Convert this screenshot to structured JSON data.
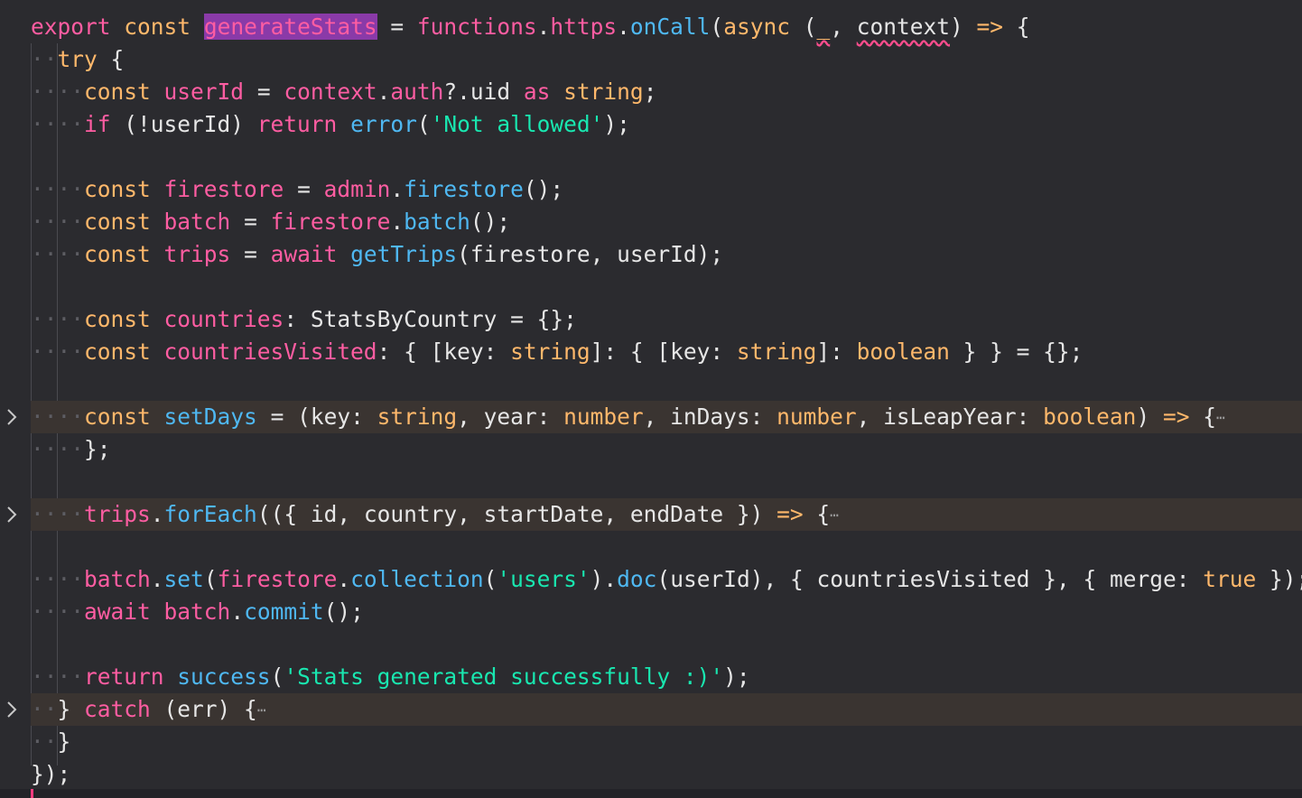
{
  "editor": {
    "colors": {
      "keyword": "#ff5da2",
      "type_or_binding": "#ffb86b",
      "function": "#4fb8f2",
      "string": "#19e7b0",
      "plain": "#e6e6e6",
      "selection": "#8a3aa8",
      "folded_line_background": "#3a3431",
      "error_squiggle": "#ff4d8d"
    },
    "lines": [
      {
        "tokens": [
          {
            "t": "export",
            "c": "kw"
          },
          {
            "t": " "
          },
          {
            "t": "const",
            "c": "tk"
          },
          {
            "t": " "
          },
          {
            "t": "generateStats",
            "c": "kw",
            "s": "sel"
          },
          {
            "t": " = "
          },
          {
            "t": "functions",
            "c": "kw"
          },
          {
            "t": "."
          },
          {
            "t": "https",
            "c": "kw"
          },
          {
            "t": "."
          },
          {
            "t": "onCall",
            "c": "fn"
          },
          {
            "t": "("
          },
          {
            "t": "async",
            "c": "tk"
          },
          {
            "t": " ("
          },
          {
            "t": "_",
            "c": "tk",
            "s": "squig"
          },
          {
            "t": ", "
          },
          {
            "t": "context",
            "c": "pl",
            "s": "squig"
          },
          {
            "t": ") "
          },
          {
            "t": "=>",
            "c": "tk"
          },
          {
            "t": " {"
          }
        ]
      },
      {
        "indent": 1,
        "tokens": [
          {
            "t": "try",
            "c": "tk"
          },
          {
            "t": " {"
          }
        ]
      },
      {
        "indent": 2,
        "tokens": [
          {
            "t": "const",
            "c": "tk"
          },
          {
            "t": " "
          },
          {
            "t": "userId",
            "c": "kw"
          },
          {
            "t": " = "
          },
          {
            "t": "context",
            "c": "kw"
          },
          {
            "t": "."
          },
          {
            "t": "auth",
            "c": "kw"
          },
          {
            "t": "?.uid "
          },
          {
            "t": "as",
            "c": "kw"
          },
          {
            "t": " "
          },
          {
            "t": "string",
            "c": "tk"
          },
          {
            "t": ";"
          }
        ]
      },
      {
        "indent": 2,
        "tokens": [
          {
            "t": "if",
            "c": "kw"
          },
          {
            "t": " (!userId) "
          },
          {
            "t": "return",
            "c": "kw"
          },
          {
            "t": " "
          },
          {
            "t": "error",
            "c": "fn"
          },
          {
            "t": "("
          },
          {
            "t": "'Not allowed'",
            "c": "str"
          },
          {
            "t": ");"
          }
        ]
      },
      {
        "tokens": []
      },
      {
        "indent": 2,
        "tokens": [
          {
            "t": "const",
            "c": "tk"
          },
          {
            "t": " "
          },
          {
            "t": "firestore",
            "c": "kw"
          },
          {
            "t": " = "
          },
          {
            "t": "admin",
            "c": "kw"
          },
          {
            "t": "."
          },
          {
            "t": "firestore",
            "c": "fn"
          },
          {
            "t": "();"
          }
        ]
      },
      {
        "indent": 2,
        "tokens": [
          {
            "t": "const",
            "c": "tk"
          },
          {
            "t": " "
          },
          {
            "t": "batch",
            "c": "kw"
          },
          {
            "t": " = "
          },
          {
            "t": "firestore",
            "c": "kw"
          },
          {
            "t": "."
          },
          {
            "t": "batch",
            "c": "fn"
          },
          {
            "t": "();"
          }
        ]
      },
      {
        "indent": 2,
        "tokens": [
          {
            "t": "const",
            "c": "tk"
          },
          {
            "t": " "
          },
          {
            "t": "trips",
            "c": "kw"
          },
          {
            "t": " = "
          },
          {
            "t": "await",
            "c": "kw"
          },
          {
            "t": " "
          },
          {
            "t": "getTrips",
            "c": "fn"
          },
          {
            "t": "(firestore, userId);"
          }
        ]
      },
      {
        "tokens": []
      },
      {
        "indent": 2,
        "tokens": [
          {
            "t": "const",
            "c": "tk"
          },
          {
            "t": " "
          },
          {
            "t": "countries",
            "c": "kw"
          },
          {
            "t": ": StatsByCountry = {};"
          }
        ]
      },
      {
        "indent": 2,
        "tokens": [
          {
            "t": "const",
            "c": "tk"
          },
          {
            "t": " "
          },
          {
            "t": "countriesVisited",
            "c": "kw"
          },
          {
            "t": ": { [key: "
          },
          {
            "t": "string",
            "c": "tk"
          },
          {
            "t": "]: { [key: "
          },
          {
            "t": "string",
            "c": "tk"
          },
          {
            "t": "]: "
          },
          {
            "t": "boolean",
            "c": "tk"
          },
          {
            "t": " } } = {};"
          }
        ]
      },
      {
        "tokens": []
      },
      {
        "indent": 2,
        "folded": true,
        "tokens": [
          {
            "t": "const",
            "c": "tk"
          },
          {
            "t": " "
          },
          {
            "t": "setDays",
            "c": "fn"
          },
          {
            "t": " = (key: "
          },
          {
            "t": "string",
            "c": "tk"
          },
          {
            "t": ", year: "
          },
          {
            "t": "number",
            "c": "tk"
          },
          {
            "t": ", inDays: "
          },
          {
            "t": "number",
            "c": "tk"
          },
          {
            "t": ", isLeapYear: "
          },
          {
            "t": "boolean",
            "c": "tk"
          },
          {
            "t": ") "
          },
          {
            "t": "=>",
            "c": "tk"
          },
          {
            "t": " {"
          },
          {
            "t": "⋯",
            "c": "ell"
          }
        ]
      },
      {
        "indent": 2,
        "tokens": [
          {
            "t": "};"
          }
        ]
      },
      {
        "tokens": []
      },
      {
        "indent": 2,
        "folded": true,
        "tokens": [
          {
            "t": "trips",
            "c": "kw"
          },
          {
            "t": "."
          },
          {
            "t": "forEach",
            "c": "fn"
          },
          {
            "t": "(({ id, country, startDate, endDate }) "
          },
          {
            "t": "=>",
            "c": "tk"
          },
          {
            "t": " {"
          },
          {
            "t": "⋯",
            "c": "ell"
          }
        ]
      },
      {
        "tokens": []
      },
      {
        "indent": 2,
        "tokens": [
          {
            "t": "batch",
            "c": "kw"
          },
          {
            "t": "."
          },
          {
            "t": "set",
            "c": "fn"
          },
          {
            "t": "("
          },
          {
            "t": "firestore",
            "c": "kw"
          },
          {
            "t": "."
          },
          {
            "t": "collection",
            "c": "fn"
          },
          {
            "t": "("
          },
          {
            "t": "'users'",
            "c": "str"
          },
          {
            "t": ")."
          },
          {
            "t": "doc",
            "c": "fn"
          },
          {
            "t": "(userId), { countriesVisited }, { merge: "
          },
          {
            "t": "true",
            "c": "tk"
          },
          {
            "t": " });"
          }
        ]
      },
      {
        "indent": 2,
        "tokens": [
          {
            "t": "await",
            "c": "kw"
          },
          {
            "t": " "
          },
          {
            "t": "batch",
            "c": "kw"
          },
          {
            "t": "."
          },
          {
            "t": "commit",
            "c": "fn"
          },
          {
            "t": "();"
          }
        ]
      },
      {
        "tokens": []
      },
      {
        "indent": 2,
        "tokens": [
          {
            "t": "return",
            "c": "kw"
          },
          {
            "t": " "
          },
          {
            "t": "success",
            "c": "fn"
          },
          {
            "t": "("
          },
          {
            "t": "'Stats generated successfully :)'",
            "c": "str"
          },
          {
            "t": ");"
          }
        ]
      },
      {
        "indent": 1,
        "folded": true,
        "tokens": [
          {
            "t": "} "
          },
          {
            "t": "catch",
            "c": "kw"
          },
          {
            "t": " (err) {"
          },
          {
            "t": "⋯",
            "c": "ell"
          }
        ]
      },
      {
        "indent": 1,
        "tokens": [
          {
            "t": "}"
          }
        ]
      },
      {
        "tokens": [
          {
            "t": "});"
          }
        ]
      }
    ]
  }
}
